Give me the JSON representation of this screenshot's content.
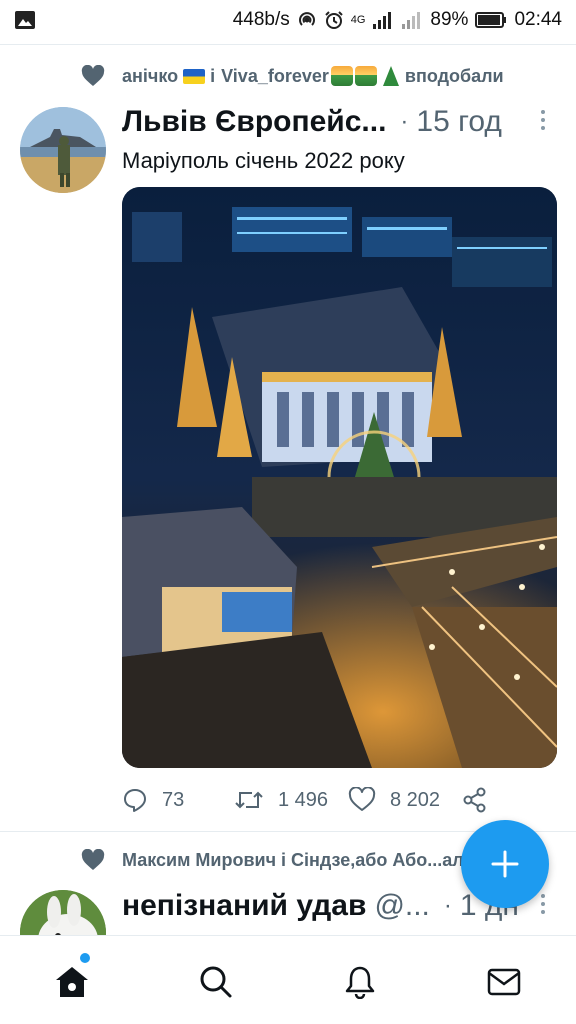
{
  "status_bar": {
    "net_speed": "448b/s",
    "network_label": "4G",
    "battery": "89%",
    "time": "02:44"
  },
  "tweet1": {
    "social_context": {
      "user1": "анічко",
      "connector": "і",
      "user2": "Viva_forever",
      "action": "вподобали"
    },
    "display_name": "Львів Європейс...",
    "time": "15 год",
    "text": "Маріуполь січень 2022 року",
    "stats": {
      "replies": "73",
      "retweets": "1 496",
      "likes": "8 202"
    }
  },
  "tweet2": {
    "social_context": "Максим Мирович і Сіндзе,або Або...али",
    "display_name": "непізнаний удав",
    "handle": "@...",
    "time": "1 дн"
  },
  "nav": {
    "items": [
      "home-icon",
      "search-icon",
      "bell-icon",
      "mail-icon"
    ]
  },
  "colors": {
    "accent": "#1d9bf0",
    "secondary_text": "#536471",
    "primary_text": "#0f1419"
  }
}
